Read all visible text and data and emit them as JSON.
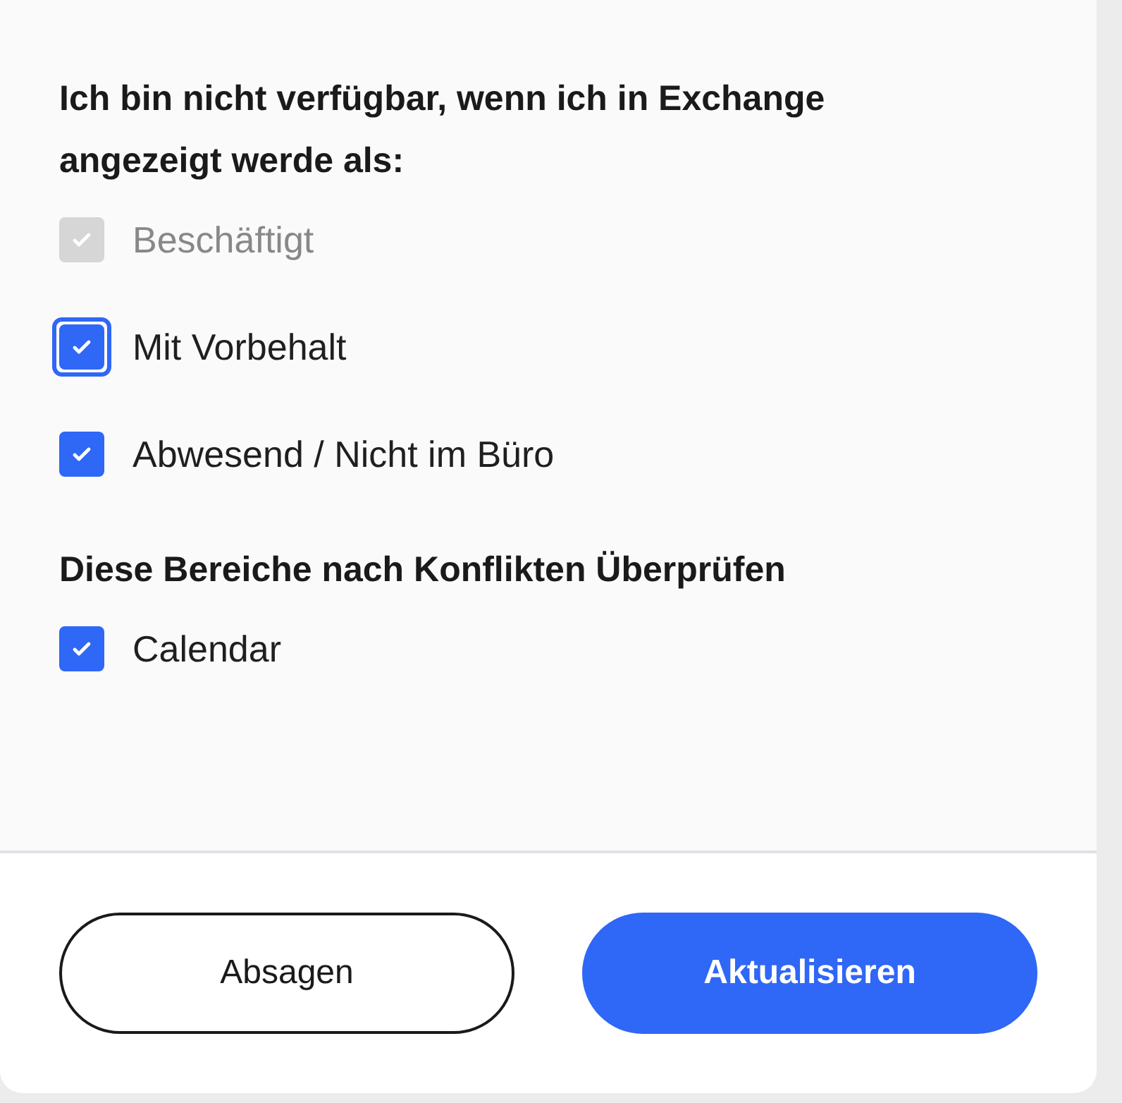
{
  "sections": [
    {
      "title": "Ich bin nicht verfügbar, wenn ich in Exchange angezeigt werde als:",
      "options": [
        {
          "label": "Beschäftigt",
          "checked": true,
          "disabled": true,
          "focused": false
        },
        {
          "label": "Mit Vorbehalt",
          "checked": true,
          "disabled": false,
          "focused": true
        },
        {
          "label": "Abwesend / Nicht im Büro",
          "checked": true,
          "disabled": false,
          "focused": false
        }
      ]
    },
    {
      "title": "Diese Bereiche nach Konflikten Überprüfen",
      "options": [
        {
          "label": "Calendar",
          "checked": true,
          "disabled": false,
          "focused": false
        }
      ]
    }
  ],
  "buttons": [
    {
      "label": "Absagen",
      "kind": "secondary"
    },
    {
      "label": "Aktualisieren",
      "kind": "primary"
    }
  ]
}
